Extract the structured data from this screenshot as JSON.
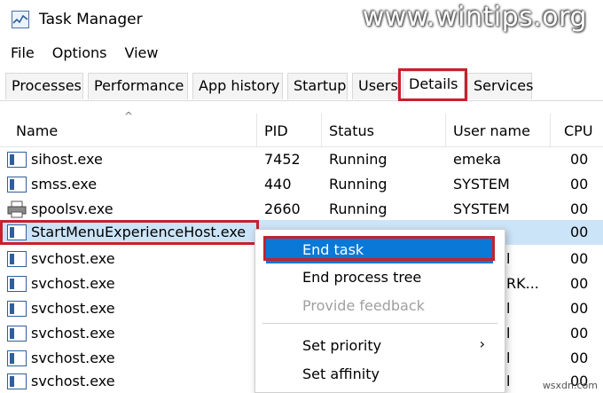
{
  "window": {
    "title": "Task Manager",
    "watermark": "www.wintips.org",
    "site_tag": "wsxdn.com"
  },
  "menu": [
    "File",
    "Options",
    "View"
  ],
  "tabs": [
    {
      "label": "Processes",
      "active": false
    },
    {
      "label": "Performance",
      "active": false
    },
    {
      "label": "App history",
      "active": false
    },
    {
      "label": "Startup",
      "active": false
    },
    {
      "label": "Users",
      "active": false
    },
    {
      "label": "Details",
      "active": true
    },
    {
      "label": "Services",
      "active": false
    }
  ],
  "columns": [
    "Name",
    "PID",
    "Status",
    "User name",
    "CPU"
  ],
  "rows": [
    {
      "name": "sihost.exe",
      "pid": "7452",
      "status": "Running",
      "user": "emeka",
      "cpu": "00",
      "icon": "process-icon"
    },
    {
      "name": "smss.exe",
      "pid": "440",
      "status": "Running",
      "user": "SYSTEM",
      "cpu": "00",
      "icon": "process-icon"
    },
    {
      "name": "spoolsv.exe",
      "pid": "2660",
      "status": "Running",
      "user": "SYSTEM",
      "cpu": "00",
      "icon": "printer-icon"
    },
    {
      "name": "StartMenuExperienceHost.exe",
      "pid": "",
      "status": "",
      "user": "",
      "cpu": "00",
      "icon": "process-icon",
      "selected": true
    },
    {
      "name": "svchost.exe",
      "pid": "",
      "status": "",
      "user": "l",
      "cpu": "00",
      "icon": "process-icon"
    },
    {
      "name": "svchost.exe",
      "pid": "",
      "status": "",
      "user": "RK...",
      "cpu": "00",
      "icon": "process-icon"
    },
    {
      "name": "svchost.exe",
      "pid": "",
      "status": "",
      "user": "l",
      "cpu": "00",
      "icon": "process-icon"
    },
    {
      "name": "svchost.exe",
      "pid": "",
      "status": "",
      "user": "l",
      "cpu": "00",
      "icon": "process-icon"
    },
    {
      "name": "svchost.exe",
      "pid": "",
      "status": "",
      "user": "l",
      "cpu": "00",
      "icon": "process-icon"
    },
    {
      "name": "svchost.exe",
      "pid": "",
      "status": "",
      "user": "l",
      "cpu": "00",
      "icon": "process-icon"
    }
  ],
  "context_menu": {
    "items": [
      {
        "label": "End task",
        "state": "highlighted"
      },
      {
        "label": "End process tree",
        "state": "normal"
      },
      {
        "label": "Provide feedback",
        "state": "disabled"
      },
      {
        "label": "Set priority",
        "state": "normal",
        "submenu_arrow": "›"
      },
      {
        "label": "Set affinity",
        "state": "normal"
      }
    ]
  },
  "colors": {
    "highlight_red": "#c8202c",
    "selection_blue": "#0a78d7",
    "row_selected": "#cce4f7"
  }
}
